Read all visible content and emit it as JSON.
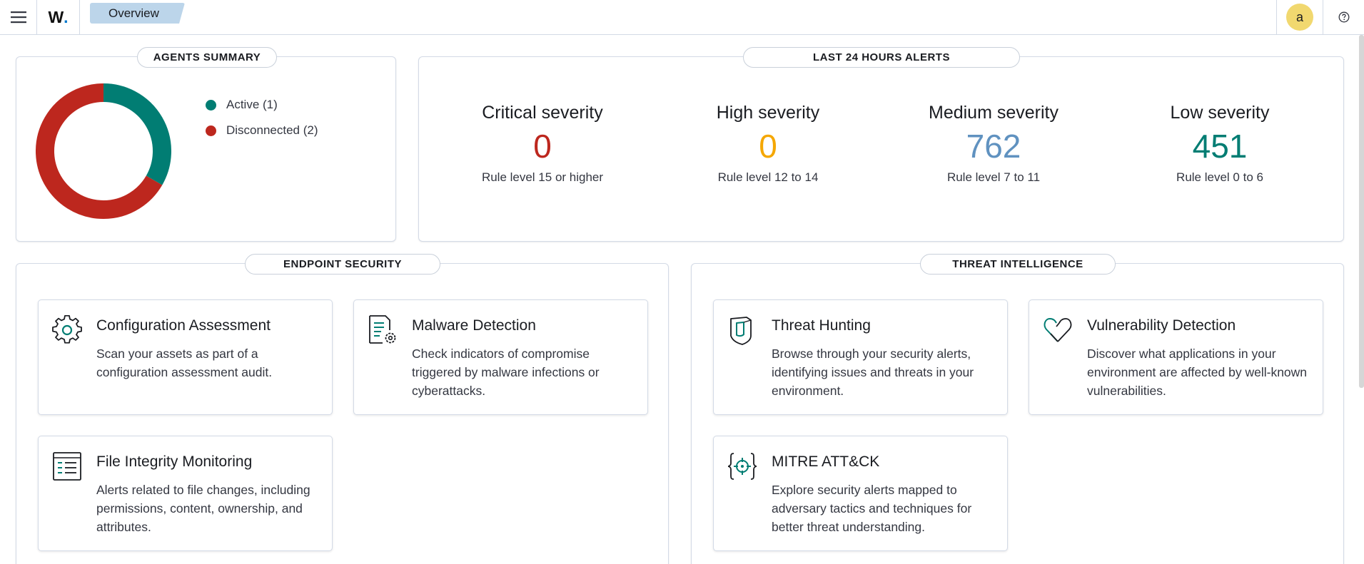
{
  "header": {
    "breadcrumb": "Overview",
    "logo_text": "W",
    "logo_dot": ".",
    "avatar_letter": "a",
    "menu_icon": "hamburger-menu-icon",
    "help_icon": "help-icon"
  },
  "colors": {
    "active": "#017d73",
    "disconnected": "#bd271e",
    "critical": "#bd271e",
    "high": "#f5a700",
    "medium": "#6092c0",
    "low": "#017d73",
    "avatar": "#f1d86f"
  },
  "agents_summary": {
    "title": "AGENTS SUMMARY",
    "active_count": 1,
    "disconnected_count": 2,
    "legend": [
      {
        "label": "Active (1)",
        "color": "#017d73"
      },
      {
        "label": "Disconnected (2)",
        "color": "#bd271e"
      }
    ]
  },
  "alerts": {
    "title": "LAST 24 HOURS ALERTS",
    "severities": [
      {
        "title": "Critical severity",
        "value": "0",
        "desc": "Rule level 15 or higher",
        "color": "#bd271e"
      },
      {
        "title": "High severity",
        "value": "0",
        "desc": "Rule level 12 to 14",
        "color": "#f5a700"
      },
      {
        "title": "Medium severity",
        "value": "762",
        "desc": "Rule level 7 to 11",
        "color": "#6092c0"
      },
      {
        "title": "Low severity",
        "value": "451",
        "desc": "Rule level 0 to 6",
        "color": "#017d73"
      }
    ]
  },
  "endpoint_security": {
    "title": "ENDPOINT SECURITY",
    "cards": [
      {
        "title": "Configuration Assessment",
        "desc": "Scan your assets as part of a configuration assessment audit.",
        "icon": "gear-icon"
      },
      {
        "title": "Malware Detection",
        "desc": "Check indicators of compromise triggered by malware infections or cyberattacks.",
        "icon": "document-gear-icon"
      },
      {
        "title": "File Integrity Monitoring",
        "desc": "Alerts related to file changes, including permissions, content, ownership, and attributes.",
        "icon": "list-document-icon"
      }
    ]
  },
  "threat_intelligence": {
    "title": "THREAT INTELLIGENCE",
    "cards": [
      {
        "title": "Threat Hunting",
        "desc": "Browse through your security alerts, identifying issues and threats in your environment.",
        "icon": "shield-icon"
      },
      {
        "title": "Vulnerability Detection",
        "desc": "Discover what applications in your environment are affected by well-known vulnerabilities.",
        "icon": "heart-broken-icon"
      },
      {
        "title": "MITRE ATT&CK",
        "desc": "Explore security alerts mapped to adversary tactics and techniques for better threat understanding.",
        "icon": "target-braces-icon"
      }
    ]
  }
}
